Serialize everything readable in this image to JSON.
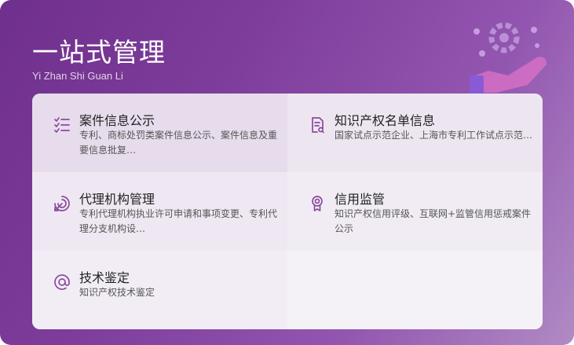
{
  "header": {
    "title": "一站式管理",
    "subtitle": "Yi Zhan Shi Guan Li"
  },
  "colors": {
    "accent": "#7a3e96",
    "icon": "#8a4a9e",
    "gradient_start": "#6f2f8c",
    "gradient_end": "#b08bc4"
  },
  "items": [
    {
      "title": "案件信息公示",
      "desc": "专利、商标处罚类案件信息公示、案件信息及重要信息批复…",
      "icon": "checklist-icon"
    },
    {
      "title": "知识产权名单信息",
      "desc": "国家试点示范企业、上海市专利工作试点示范…",
      "icon": "document-icon"
    },
    {
      "title": "代理机构管理",
      "desc": "专利代理机构执业许可申请和事项变更、专利代理分支机构设…",
      "icon": "target-arrow-icon"
    },
    {
      "title": "信用监管",
      "desc": "知识产权信用评级、互联网+监管信用惩戒案件公示",
      "icon": "badge-icon"
    },
    {
      "title": "技术鉴定",
      "desc": "知识产权技术鉴定",
      "icon": "at-icon"
    }
  ]
}
